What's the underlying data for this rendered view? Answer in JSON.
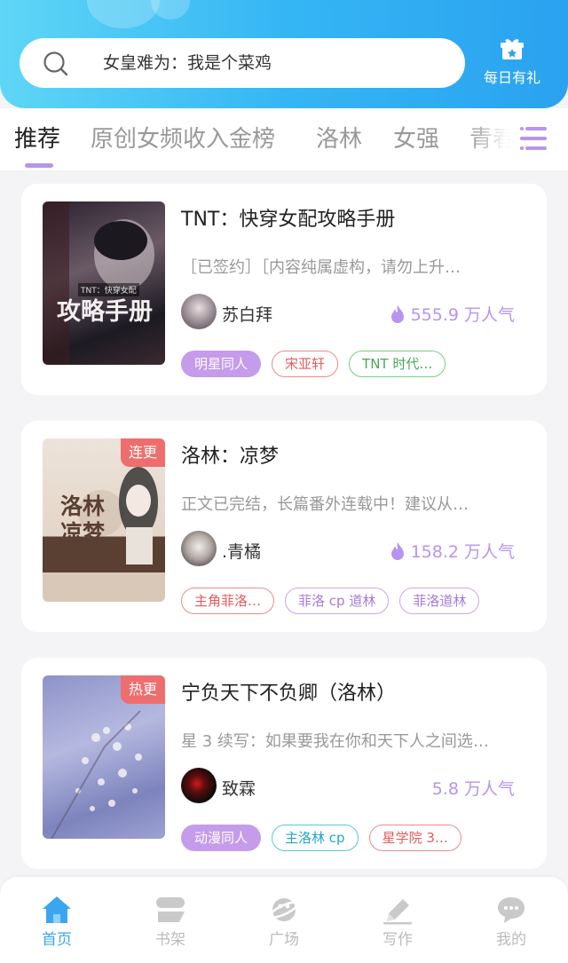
{
  "search": {
    "placeholder_text": "女皇难为：我是个菜鸡"
  },
  "gift": {
    "label": "每日有礼",
    "icon": "gift-icon"
  },
  "tabs": [
    {
      "label": "推荐",
      "active": true
    },
    {
      "label": "原创女频收入金榜"
    },
    {
      "label": "洛林"
    },
    {
      "label": "女强"
    },
    {
      "label": "青春"
    }
  ],
  "books": [
    {
      "title": "TNT：快穿女配攻略手册",
      "description": "［已签约］［内容纯属虚构，请勿上升…",
      "author": "苏白拜",
      "popularity": "555.9 万人气",
      "show_flame": true,
      "badge": "",
      "cover_text": "攻略手册",
      "cover_small": "TNT：快穿女配",
      "tags": [
        {
          "label": "明星同人",
          "style": "filled"
        },
        {
          "label": "宋亚轩",
          "style": "red"
        },
        {
          "label": "TNT 时代…",
          "style": "green"
        }
      ]
    },
    {
      "title": "洛林：凉梦",
      "description": "正文已完结，长篇番外连载中！建议从…",
      "author": ".青橘",
      "popularity": "158.2 万人气",
      "show_flame": true,
      "badge": "连更",
      "cover_text": "洛林凉梦",
      "cover_small": "",
      "tags": [
        {
          "label": "主角菲洛…",
          "style": "red"
        },
        {
          "label": "菲洛 cp 道林",
          "style": "purple"
        },
        {
          "label": "菲洛道林",
          "style": "purple"
        }
      ]
    },
    {
      "title": "宁负天下不负卿（洛林）",
      "description": "星 3 续写：如果要我在你和天下人之间选…",
      "author": "致霖",
      "popularity": "5.8 万人气",
      "show_flame": false,
      "badge": "热更",
      "cover_text": "",
      "cover_small": "",
      "tags": [
        {
          "label": "动漫同人",
          "style": "filled"
        },
        {
          "label": "主洛林 cp",
          "style": "cyan"
        },
        {
          "label": "星学院 3…",
          "style": "red"
        }
      ]
    }
  ],
  "nav": [
    {
      "label": "首页",
      "icon": "home-icon",
      "active": true
    },
    {
      "label": "书架",
      "icon": "bookshelf-icon"
    },
    {
      "label": "广场",
      "icon": "planet-icon"
    },
    {
      "label": "写作",
      "icon": "pencil-icon"
    },
    {
      "label": "我的",
      "icon": "chat-bubble-icon"
    }
  ],
  "colors": {
    "accent": "#b794ef",
    "header_start": "#5fd6f6",
    "header_end": "#2aa2f0",
    "nav_active": "#3aa6f0"
  }
}
